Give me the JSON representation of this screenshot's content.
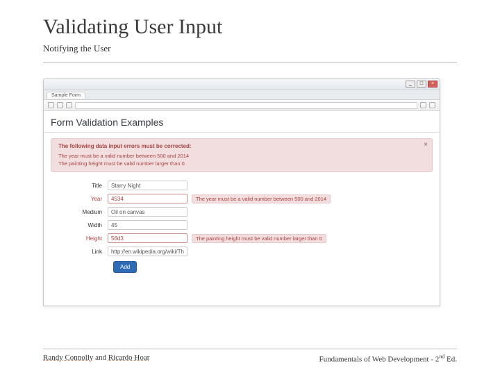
{
  "slide": {
    "title": "Validating User Input",
    "subtitle": "Notifying the User"
  },
  "browser": {
    "tab_label": "Sample Form",
    "win_min": "_",
    "win_max": "□",
    "win_close": "×"
  },
  "page": {
    "heading": "Form Validation Examples"
  },
  "alert": {
    "heading": "The following data input errors must be corrected:",
    "items": [
      "The year must be a valid number between 500 and 2014",
      "The painting height must be valid number larger than 0"
    ],
    "close_glyph": "×"
  },
  "form": {
    "fields": [
      {
        "label": "Title",
        "value": "Starry Night",
        "error": false,
        "msg": ""
      },
      {
        "label": "Year",
        "value": "4534",
        "error": true,
        "msg": "The year must be a valid number between 500 and 2014"
      },
      {
        "label": "Medium",
        "value": "Oil on canvas",
        "error": false,
        "msg": ""
      },
      {
        "label": "Width",
        "value": "45",
        "error": false,
        "msg": ""
      },
      {
        "label": "Height",
        "value": "56d3",
        "error": true,
        "msg": "The painting height must be valid number larger than 0"
      },
      {
        "label": "Link",
        "value": "http://en.wikipedia.org/wiki/The_Starry_Ni",
        "error": false,
        "msg": ""
      }
    ],
    "submit_label": "Add"
  },
  "footer": {
    "author1": "Randy Connolly",
    "author_join": " and ",
    "author2": "Ricardo Hoar",
    "book_prefix": "Fundamentals of Web Development - 2",
    "book_sup": "nd",
    "book_suffix": " Ed."
  }
}
